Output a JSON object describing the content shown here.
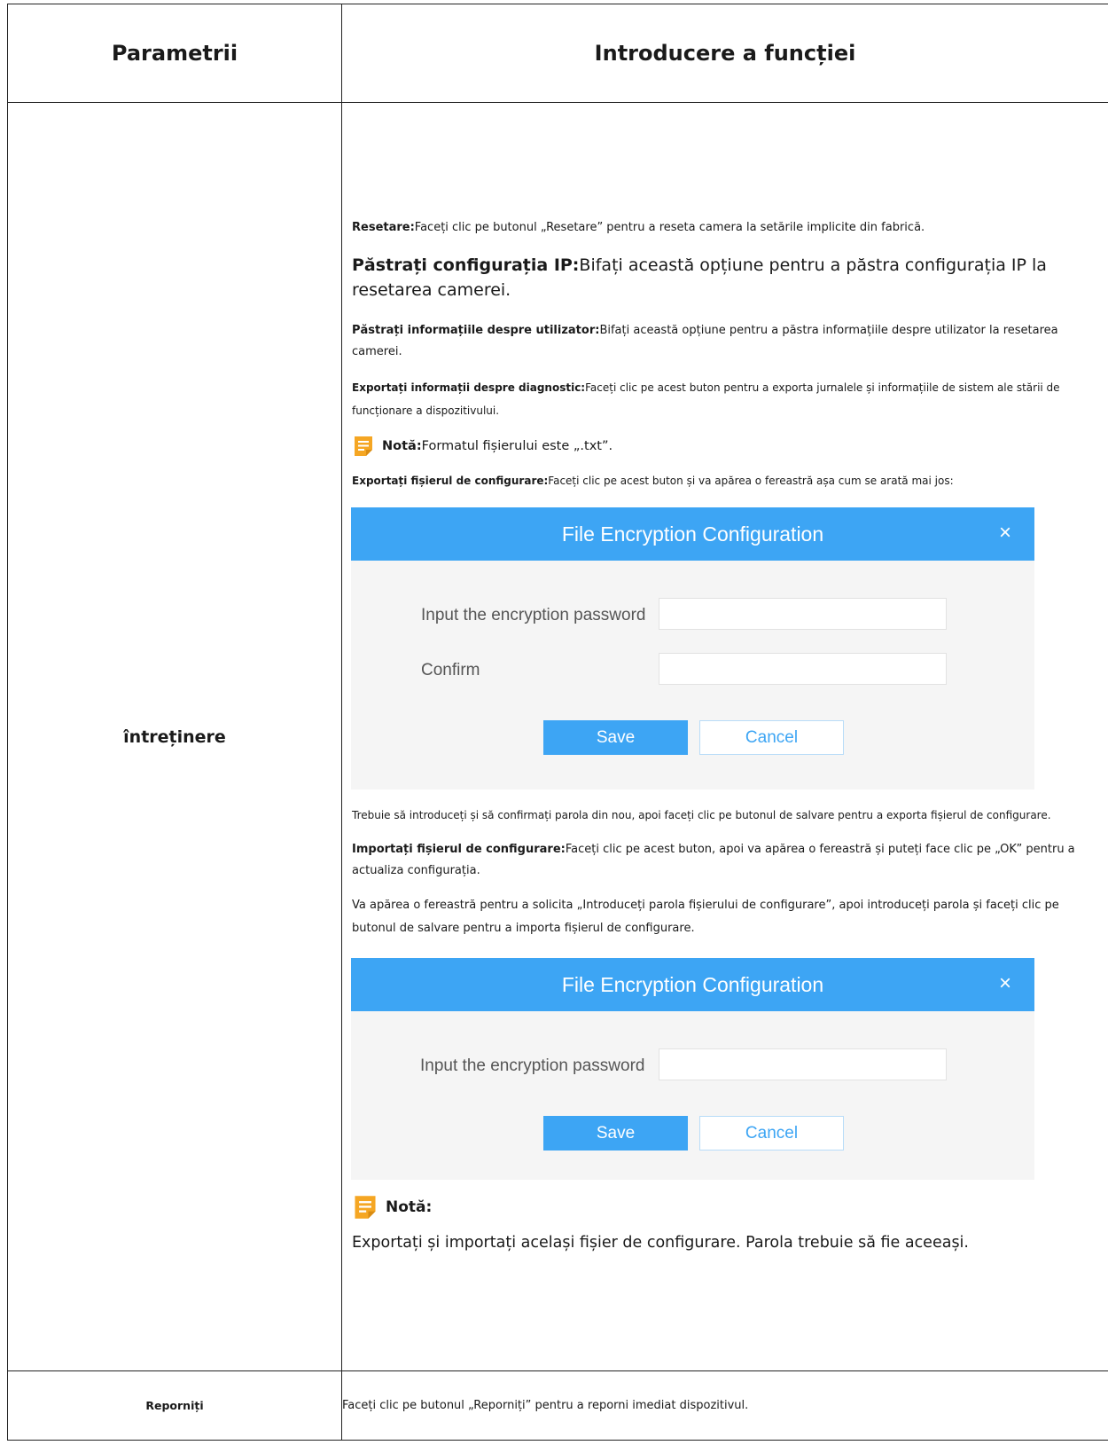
{
  "table": {
    "header_param": "Parametrii",
    "header_desc": "Introducere a funcției"
  },
  "row1": {
    "param": "întreținere",
    "reset_label": "Resetare:",
    "reset_text": "Faceți clic pe butonul „Resetare” pentru a reseta camera la setările implicite din fabrică.",
    "keep_ip_label": "Păstrați configurația IP:",
    "keep_ip_text": "Bifați această opțiune pentru a păstra configurația IP la resetarea camerei.",
    "keep_user_label": "Păstrați informațiile despre utilizator:",
    "keep_user_text": "Bifați această opțiune pentru a păstra informațiile despre utilizator la resetarea camerei.",
    "diag_label": "Exportați informații despre diagnostic:",
    "diag_text": "Faceți clic pe acest buton pentru a exporta jurnalele și informațiile de sistem ale stării de funcționare a dispozitivului.",
    "note1_label": "Notă:",
    "note1_text": "Formatul fișierului este „.txt”.",
    "export_cfg_label": "Exportați fișierul de configurare:",
    "export_cfg_text": "Faceți clic pe acest buton și va apărea o fereastră așa cum se arată mai jos:",
    "export_after_text": "Trebuie să introduceți și să confirmați parola din nou, apoi faceți clic pe butonul de salvare pentru a exporta fișierul de configurare.",
    "import_cfg_label": "Importați fișierul de configurare:",
    "import_cfg_text": "Faceți clic pe acest buton, apoi va apărea o fereastră și puteți face clic pe „OK” pentru a actualiza configurația.",
    "import_prompt_text": "Va apărea o fereastră pentru a solicita „Introduceți parola fișierului de configurare”, apoi introduceți parola și faceți clic pe butonul de salvare pentru a importa fișierul de configurare.",
    "note2_label": "Notă:",
    "note2_text": "Exportați și importați același fișier de configurare. Parola trebuie să fie aceeași."
  },
  "dialog_export": {
    "title": "File Encryption Configuration",
    "close": "×",
    "password_label": "Input the encryption password",
    "confirm_label": "Confirm",
    "save": "Save",
    "cancel": "Cancel"
  },
  "dialog_import": {
    "title": "File Encryption Configuration",
    "close": "×",
    "password_label": "Input the encryption password",
    "save": "Save",
    "cancel": "Cancel"
  },
  "row2": {
    "param": "Reporniți",
    "text": "Faceți clic pe butonul „Reporniți” pentru a reporni imediat dispozitivul."
  },
  "colors": {
    "accent": "#3da5f4",
    "note_icon": "#f5a623"
  }
}
